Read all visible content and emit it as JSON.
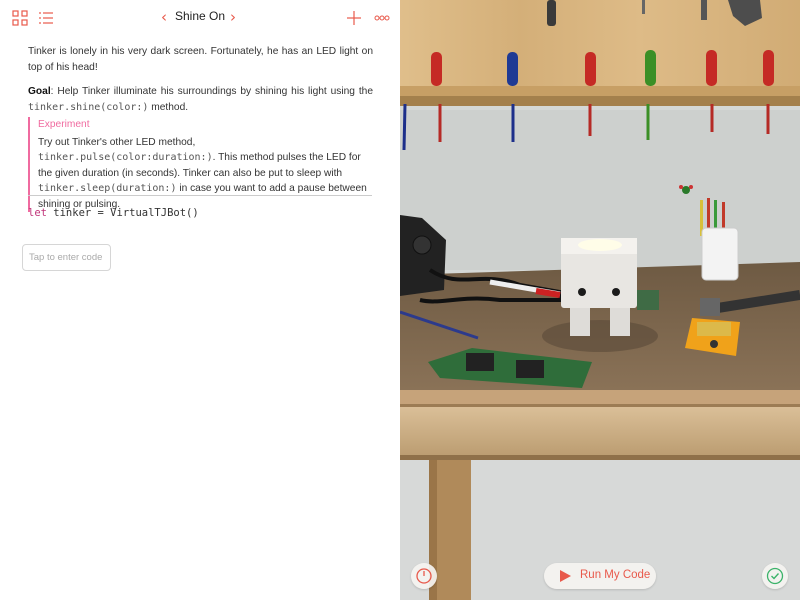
{
  "nav": {
    "title": "Shine On",
    "back_chevron": "‹",
    "forward_chevron": "›",
    "icons": [
      "grid-icon",
      "list-icon",
      "plus-icon",
      "more-icon"
    ]
  },
  "prose": {
    "intro": "Tinker is lonely in his very dark screen. Fortunately, he has an LED light on top of his head!",
    "goal_label": "Goal",
    "goal_text_1": ": Help Tinker illuminate his surroundings by shining his light using the ",
    "goal_code": "tinker.shine(color:)",
    "goal_text_2": " method."
  },
  "experiment": {
    "heading": "Experiment",
    "t1": "Try out Tinker's other LED method, ",
    "c1": "tinker.pulse(color:duration:)",
    "t2": ". This method pulses the LED for the given duration (in seconds). Tinker can also be put to sleep with ",
    "c2": "tinker.sleep(duration:)",
    "t3": " in case you want to add a pause between shining or pulsing."
  },
  "code": {
    "keyword": "let",
    "rest": " tinker = VirtualTJBot()"
  },
  "editor": {
    "placeholder": "Tap to enter code"
  },
  "run": {
    "label": "Run My Code"
  },
  "colors": {
    "accent": "#e8594b",
    "experiment": "#f06ba0",
    "keyword": "#c0357a",
    "success": "#3cb36a"
  }
}
